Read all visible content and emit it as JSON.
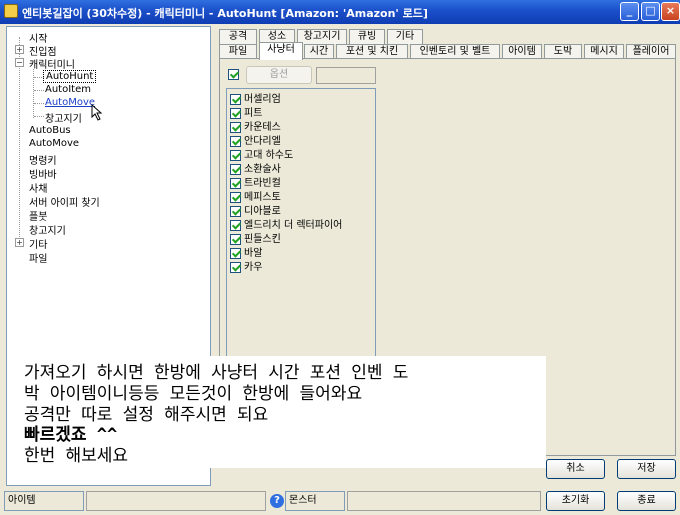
{
  "window": {
    "title": "엔티봇길잡이 (30차수정) - 캐릭터미니 - AutoHunt [Amazon: 'Amazon' 로드]",
    "buttons": {
      "minimize": "_",
      "maximize": "□",
      "close": "×"
    }
  },
  "tree": {
    "items": [
      {
        "label": "시작"
      },
      {
        "label": "진입점",
        "expander": "+"
      },
      {
        "label": "캐릭터미니",
        "expander": "−"
      },
      {
        "label": "AutoHunt"
      },
      {
        "label": "AutoItem"
      },
      {
        "label": "AutoMove"
      },
      {
        "label": "창고지기"
      },
      {
        "label": "AutoBus"
      },
      {
        "label": "AutoMove"
      },
      {
        "label": "명령키"
      },
      {
        "label": "빙바바"
      },
      {
        "label": "사채"
      },
      {
        "label": "서버 아이피 찾기"
      },
      {
        "label": "플붓"
      },
      {
        "label": "창고지기"
      },
      {
        "label": "기타",
        "expander": "+"
      },
      {
        "label": "파일"
      }
    ]
  },
  "tabs": {
    "row1": [
      "공격",
      "성소",
      "창고지기",
      "큐빙",
      "기타"
    ],
    "row2": [
      "파일",
      "사냥터",
      "시간",
      "포션 및 치킨",
      "인벤토리 및 벨트",
      "아이템",
      "도박",
      "메시지",
      "플레이어"
    ],
    "active": "사냥터"
  },
  "panel": {
    "option_button": "옵션",
    "hunting_areas": [
      "머셀리엄",
      "피트",
      "카운테스",
      "안다리엘",
      "고대 하수도",
      "소환술사",
      "트라빈컬",
      "메피스토",
      "디아블로",
      "엘드리치 더 렉터파이어",
      "핀들스킨",
      "바알",
      "카우"
    ]
  },
  "overlay": {
    "lines": [
      "가져오기 하시면 한방에 사냥터 시간 포션 인벤 도",
      "박 아이템이니등등 모든것이 한방에 들어와요",
      "공격만 따로 설정 해주시면 되요",
      "빠르겠죠 ^^",
      "한번 해보세요"
    ]
  },
  "buttons": {
    "cancel": "취소",
    "save": "저장",
    "reset": "초기화",
    "exit": "종료"
  },
  "statusbar": {
    "item_label": "아이템",
    "monster_label": "몬스터",
    "help_icon_glyph": "?"
  },
  "colors": {
    "title_bar": "#1b4fc9",
    "link": "#1a3fc9",
    "check": "#21a121"
  }
}
